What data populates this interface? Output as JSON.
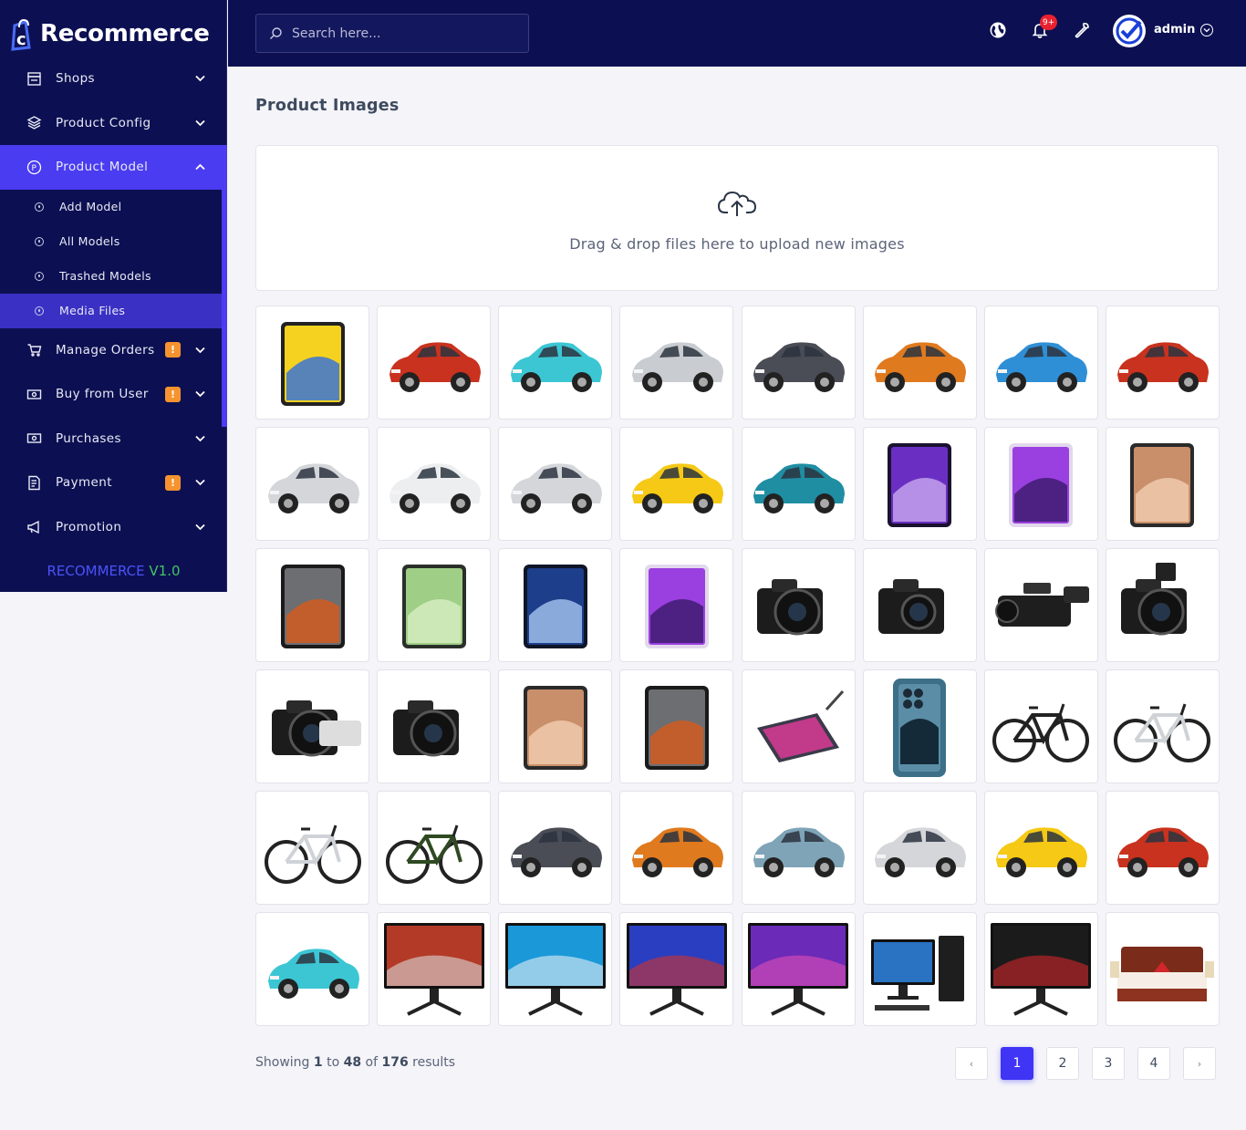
{
  "brand": {
    "name": "Recommerce"
  },
  "sidebar": {
    "items": [
      {
        "label": "Shops",
        "icon": "shop-icon",
        "expanded": false,
        "badge": ""
      },
      {
        "label": "Product Config",
        "icon": "config-icon",
        "expanded": false,
        "badge": ""
      },
      {
        "label": "Product Model",
        "icon": "product-icon",
        "expanded": true,
        "badge": ""
      },
      {
        "label": "Manage Orders",
        "icon": "cart-icon",
        "expanded": false,
        "badge": "!"
      },
      {
        "label": "Buy from User",
        "icon": "cash-icon",
        "expanded": false,
        "badge": "!"
      },
      {
        "label": "Purchases",
        "icon": "cash-icon",
        "expanded": false,
        "badge": ""
      },
      {
        "label": "Payment",
        "icon": "invoice-icon",
        "expanded": false,
        "badge": "!"
      },
      {
        "label": "Promotion",
        "icon": "megaphone-icon",
        "expanded": false,
        "badge": ""
      }
    ],
    "submenu": [
      {
        "label": "Add Model"
      },
      {
        "label": "All Models"
      },
      {
        "label": "Trashed Models"
      },
      {
        "label": "Media Files"
      }
    ],
    "version_brand": "RECOMMERCE",
    "version_num": "V1.0"
  },
  "header": {
    "search_placeholder": "Search here...",
    "notification_count": "9+",
    "user_name": "admin"
  },
  "main": {
    "title": "Product Images",
    "dropzone_text": "Drag & drop files here to upload new images"
  },
  "images": [
    "tablet-yellow",
    "car-red",
    "car-cyan-suv",
    "car-silver-suv",
    "car-dark-crossover",
    "car-orange-crossover",
    "car-blue-coupe",
    "car-red",
    "car-silver-hatch",
    "car-white-sedan",
    "car-silver-hatch",
    "car-yellow-hatch",
    "car-teal-suv",
    "tablet-purple",
    "tablet-purple-light",
    "tablet-bronze",
    "tablet-gray",
    "tablet-green",
    "tablet-blue",
    "tablet-purple-light",
    "camera-dslr",
    "camera-compact",
    "camcorder",
    "camera-flash",
    "camera-telephoto",
    "camera-mirrorless",
    "tablet-bronze",
    "tablet-gray",
    "tablet-pen",
    "phone-blue",
    "bicycle-black",
    "bicycle-white",
    "bicycle-white",
    "bicycle-green",
    "car-dark-crossover",
    "car-orange-crossover",
    "car-classic-blue",
    "car-silver-hatch",
    "car-yellow-hatch",
    "car-red",
    "car-cyan-suv",
    "monitor-landscape",
    "monitor-sky",
    "monitor-gaming",
    "monitor-neon",
    "desktop-pc",
    "monitor-red",
    "bed"
  ],
  "pagination": {
    "from": "1",
    "to": "48",
    "total": "176",
    "pages": [
      "1",
      "2",
      "3",
      "4"
    ],
    "current": "1",
    "prev": "‹",
    "next": "›"
  },
  "colors": {
    "sidebar_bg": "#0c1052",
    "accent": "#4a3cf0",
    "warning": "#f7932e",
    "danger": "#e8212f"
  }
}
